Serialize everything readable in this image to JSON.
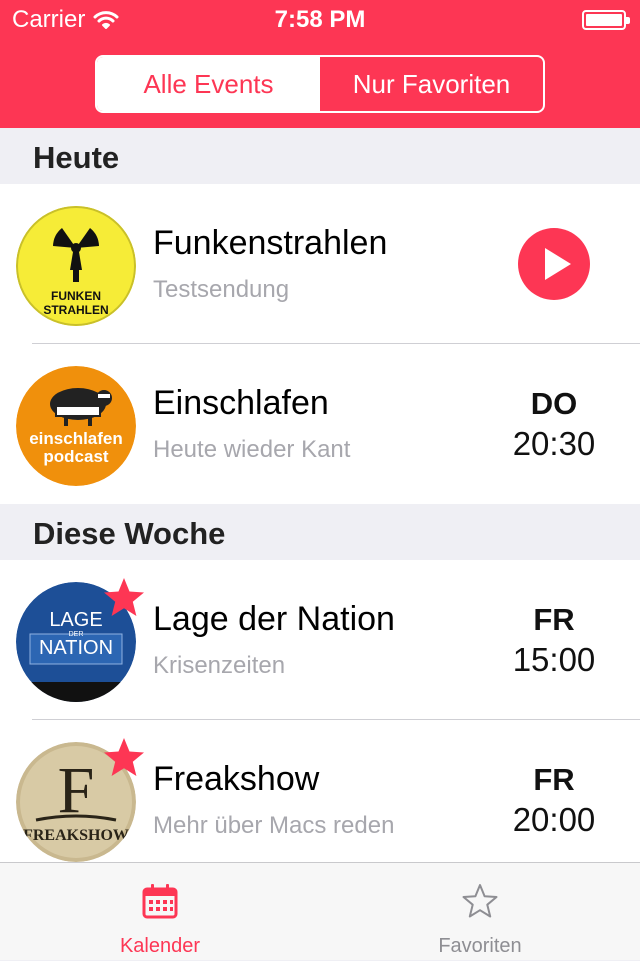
{
  "status_bar": {
    "carrier": "Carrier",
    "time": "7:58 PM"
  },
  "segmented": {
    "all_label": "Alle Events",
    "favorites_label": "Nur Favoriten",
    "selected": "Alle Events"
  },
  "sections": [
    {
      "title": "Heute"
    },
    {
      "title": "Diese Woche"
    }
  ],
  "events": [
    {
      "title": "Funkenstrahlen",
      "subtitle": "Testsendung",
      "live": true,
      "favorite": false,
      "logo": {
        "line1": "FUNKEN",
        "line2": "STRAHLEN"
      }
    },
    {
      "title": "Einschlafen",
      "subtitle": "Heute wieder Kant",
      "day": "DO",
      "time": "20:30",
      "favorite": false,
      "logo": {
        "line1": "einschlafen",
        "line2": "podcast"
      }
    },
    {
      "title": "Lage der Nation",
      "subtitle": "Krisenzeiten",
      "day": "FR",
      "time": "15:00",
      "favorite": true,
      "logo": {
        "line1": "LAGE",
        "line2": "DER",
        "line3": "NATION"
      }
    },
    {
      "title": "Freakshow",
      "subtitle": "Mehr über Macs reden",
      "day": "FR",
      "time": "20:00",
      "favorite": true,
      "logo": {
        "line1": "F",
        "line2": "FREAKSHOW"
      }
    }
  ],
  "tabbar": {
    "items": [
      {
        "label": "Kalender",
        "icon": "calendar-icon",
        "active": true
      },
      {
        "label": "Favoriten",
        "icon": "star-outline-icon",
        "active": false
      }
    ]
  },
  "colors": {
    "accent": "#fd3654",
    "section_bg": "#efeff4",
    "subtitle": "#a7a7ad",
    "tab_inactive": "#8e8e93"
  }
}
